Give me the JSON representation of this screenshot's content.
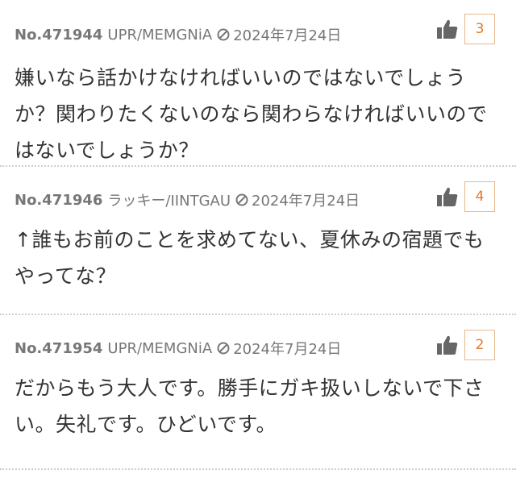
{
  "posts": [
    {
      "number": "No.471944",
      "author": "UPR/MEMGNiA",
      "date": "2024年7月24日",
      "likes": "3",
      "body": "嫌いなら話かけなければいいのではないでしょうか？関わりたくないのなら関わらなければいいのではないでしょうか？"
    },
    {
      "number": "No.471946",
      "author": "ラッキー/IINTGAU",
      "date": "2024年7月24日",
      "likes": "4",
      "body": "↑誰もお前のことを求めてない、夏休みの宿題でもやってな？"
    },
    {
      "number": "No.471954",
      "author": "UPR/MEMGNiA",
      "date": "2024年7月24日",
      "likes": "2",
      "body": "だからもう大人です。勝手にガキ扱いしないで下さい。失礼です。ひどいです。"
    }
  ],
  "icons": {
    "like": "thumbs-up-icon",
    "ban": "prohibited-icon"
  },
  "colors": {
    "accent": "#e07b2a",
    "meta": "#777777",
    "text": "#333333"
  }
}
